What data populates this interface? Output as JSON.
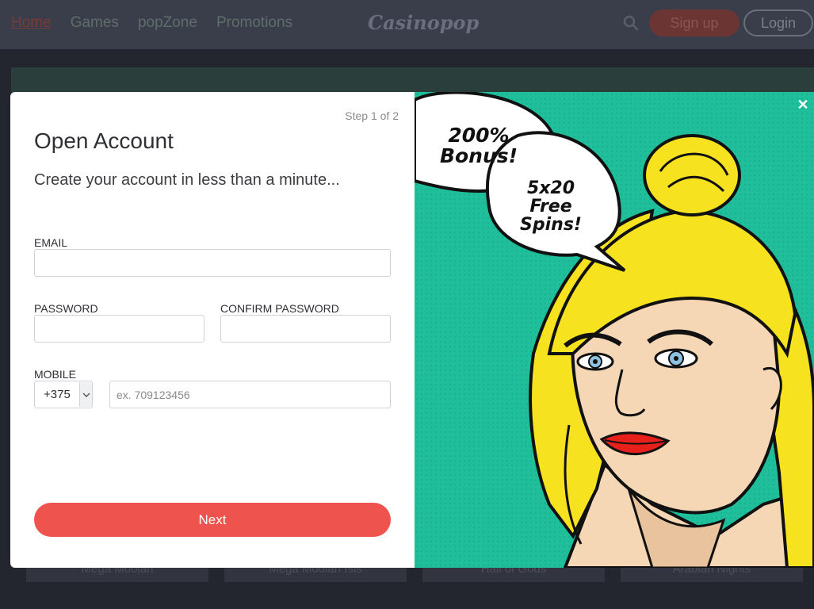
{
  "nav": {
    "items": [
      {
        "label": "Home",
        "active": true
      },
      {
        "label": "Games",
        "active": false
      },
      {
        "label": "popZone",
        "active": false
      },
      {
        "label": "Promotions",
        "active": false
      }
    ],
    "logo": "Casinopop",
    "signup_label": "Sign up",
    "login_label": "Login"
  },
  "background_cards": [
    "Mega Moolah",
    "Mega Moolah Isis",
    "Hall of Gods",
    "Arabian Nights"
  ],
  "modal": {
    "step": "Step 1 of 2",
    "title": "Open Account",
    "subtitle": "Create your account in less than a minute...",
    "email_label": "EMAIL",
    "email_value": "",
    "password_label": "PASSWORD",
    "password_value": "",
    "confirm_password_label": "CONFIRM PASSWORD",
    "confirm_password_value": "",
    "mobile_label": "MOBILE",
    "mobile_prefix": "+375",
    "mobile_placeholder": "ex. 709123456",
    "mobile_value": "",
    "next_label": "Next",
    "close_icon": "close-icon"
  },
  "promo": {
    "bubble1": "200% Bonus!",
    "bubble2": "5x20 Free Spins!"
  },
  "colors": {
    "accent": "#ef534d",
    "promo_bg": "#1fbf9b",
    "hair": "#f7e21f"
  }
}
